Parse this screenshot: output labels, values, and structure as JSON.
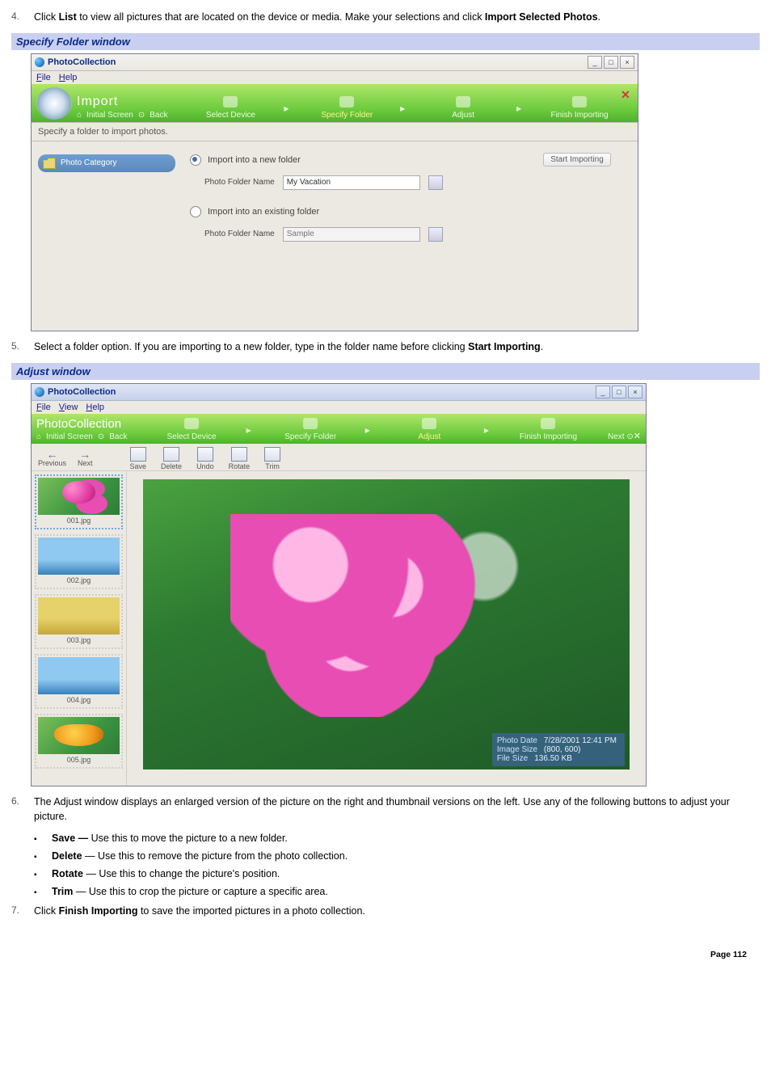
{
  "steps": {
    "4": {
      "num": "4.",
      "pre": "Click ",
      "b1": "List",
      "mid": " to view all pictures that are located on the device or media. Make your selections and click ",
      "b2": "Import Selected Photos",
      "post": "."
    },
    "5": {
      "num": "5.",
      "text_a": "Select a folder option. If you are importing to a new folder, type in the folder name before clicking ",
      "b": "Start Importing",
      "text_b": "."
    },
    "6": {
      "num": "6.",
      "text": "The Adjust window displays an enlarged version of the picture on the right and thumbnail versions on the left. Use any of the following buttons to adjust your picture."
    },
    "7": {
      "num": "7.",
      "a": "Click ",
      "b": "Finish Importing",
      "c": " to save the imported pictures in a photo collection."
    }
  },
  "bullets": {
    "save": {
      "term": "Save —",
      "desc": " Use this to move the picture to a new folder."
    },
    "delete": {
      "term": "Delete",
      "dash": " — ",
      "desc": "Use this to remove the picture from the photo collection."
    },
    "rotate": {
      "term": "Rotate",
      "dash": " — ",
      "desc": "Use this to change the picture's position."
    },
    "trim": {
      "term": "Trim",
      "dash": " — ",
      "desc": "Use this to crop the picture or capture a specific area."
    }
  },
  "headings": {
    "specify": "Specify Folder window",
    "adjust": "Adjust window"
  },
  "win_specify": {
    "title": "PhotoCollection",
    "win_controls": {
      "min": "_",
      "max": "□",
      "close": "×"
    },
    "menu": {
      "file": "File",
      "help": "Help"
    },
    "banner": {
      "title": "Import",
      "sub_home": "Initial Screen",
      "sub_back": "Back",
      "steps": {
        "1": "Select Device",
        "2": "Specify Folder",
        "3": "Adjust",
        "4": "Finish Importing"
      }
    },
    "hint": "Specify a folder to import photos.",
    "left_category": "Photo Category",
    "form": {
      "opt_new": "Import into a new folder",
      "opt_existing": "Import into an existing folder",
      "label": "Photo Folder Name",
      "new_value": "My Vacation",
      "existing_placeholder": "Sample"
    },
    "start_btn": "Start Importing"
  },
  "win_adjust": {
    "title": "PhotoCollection",
    "win_controls": {
      "min": "_",
      "max": "□",
      "close": "×"
    },
    "menu": {
      "file": "File",
      "view": "View",
      "help": "Help"
    },
    "banner": {
      "title": "PhotoCollection",
      "sub_home": "Initial Screen",
      "sub_back": "Back",
      "next": "Next",
      "steps": {
        "1": "Select Device",
        "2": "Specify Folder",
        "3": "Adjust",
        "4": "Finish Importing"
      }
    },
    "nav": {
      "prev": "Previous",
      "next": "Next"
    },
    "tools": {
      "save": "Save",
      "delete": "Delete",
      "undo": "Undo",
      "rotate": "Rotate",
      "trim": "Trim"
    },
    "thumbs": {
      "1": "001.jpg",
      "2": "002.jpg",
      "3": "003.jpg",
      "4": "004.jpg",
      "5": "005.jpg"
    },
    "info": {
      "date_label": "Photo Date",
      "date_value": "7/28/2001 12:41 PM",
      "size_label": "Image Size",
      "size_value": "(800, 600)",
      "file_label": "File Size",
      "file_value": "136.50 KB"
    }
  },
  "page_footer": "Page 112"
}
